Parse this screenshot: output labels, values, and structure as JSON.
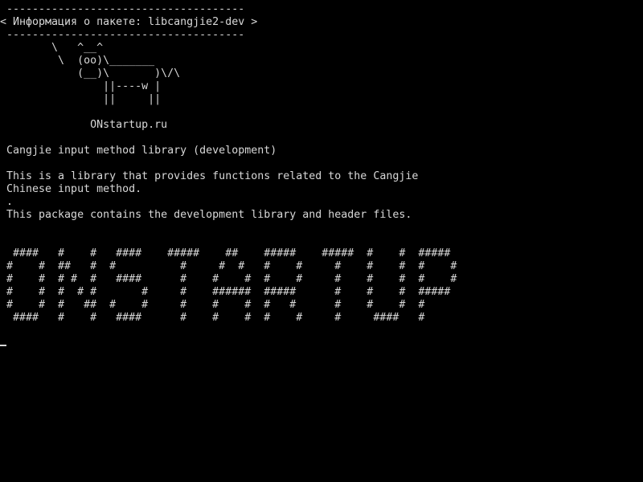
{
  "terminal": {
    "lines": [
      " -------------------------------------",
      "< Информация о пакете: libcangjie2-dev >",
      " -------------------------------------",
      "        \\   ^__^",
      "         \\  (oo)\\_______",
      "            (__)\\       )\\/\\",
      "                ||----w |",
      "                ||     ||",
      "",
      "              ONstartup.ru",
      "",
      " Cangjie input method library (development)",
      "",
      " This is a library that provides functions related to the Cangjie",
      " Chinese input method.",
      " .",
      " This package contains the development library and header files.",
      "",
      "",
      "  ####   #    #   ####    #####    ##    #####    #####  #    #  #####",
      " #    #  ##   #  #          #     #  #   #    #     #    #    #  #    #",
      " #    #  # #  #   ####      #    #    #  #    #     #    #    #  #    #",
      " #    #  #  # #       #     #    ######  #####      #    #    #  #####",
      " #    #  #   ##  #    #     #    #    #  #   #      #    #    #  #",
      "  ####   #    #   ####      #    #    #  #    #     #     ####   #"
    ]
  }
}
